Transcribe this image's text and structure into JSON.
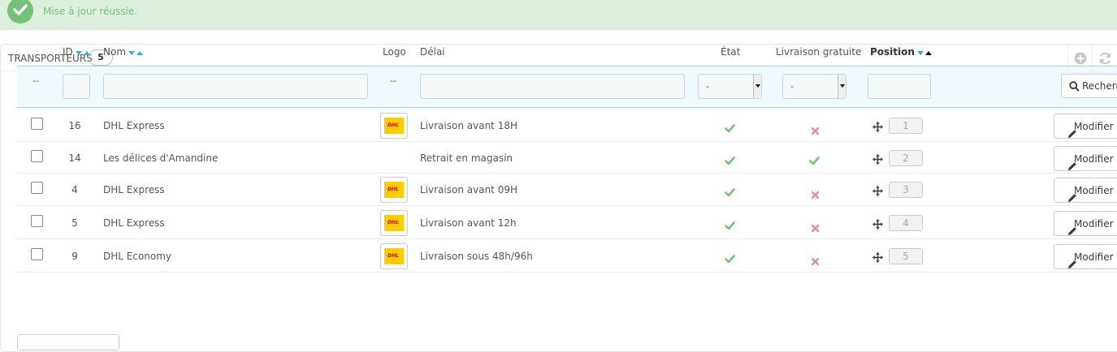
{
  "alert": {
    "message": "Mise à jour réussie."
  },
  "panel": {
    "title": "TRANSPORTEURS",
    "count": "5"
  },
  "columns": {
    "id": "ID",
    "nom": "Nom",
    "logo": "Logo",
    "delai": "Délai",
    "etat": "État",
    "gratuit": "Livraison gratuite",
    "position": "Position"
  },
  "filters": {
    "dash1": "--",
    "dash2": "--",
    "etat_value": "-",
    "gratuit_value": "-",
    "search_label": "Rechercher"
  },
  "rows": [
    {
      "id": "16",
      "nom": "DHL Express",
      "has_logo": true,
      "delai": "Livraison avant 18H",
      "etat": "yes",
      "gratuit": "no",
      "position": "1"
    },
    {
      "id": "14",
      "nom": "Les délices d'Amandine",
      "has_logo": false,
      "delai": "Retrait en magasin",
      "etat": "yes",
      "gratuit": "yes",
      "position": "2"
    },
    {
      "id": "4",
      "nom": "DHL Express",
      "has_logo": true,
      "delai": "Livraison avant 09H",
      "etat": "yes",
      "gratuit": "no",
      "position": "3"
    },
    {
      "id": "5",
      "nom": "DHL Express",
      "has_logo": true,
      "delai": "Livraison avant 12h",
      "etat": "yes",
      "gratuit": "no",
      "position": "4"
    },
    {
      "id": "9",
      "nom": "DHL Economy",
      "has_logo": true,
      "delai": "Livraison sous 48h/96h",
      "etat": "yes",
      "gratuit": "no",
      "position": "5"
    }
  ],
  "row_actions": {
    "modify_label": "Modifier"
  },
  "logo_text": "DHL",
  "colors": {
    "success": "#72c279",
    "error": "#e08f95",
    "accent": "#25b9d7",
    "logo_yellow": "#ffcc00",
    "logo_red": "#d40511"
  }
}
